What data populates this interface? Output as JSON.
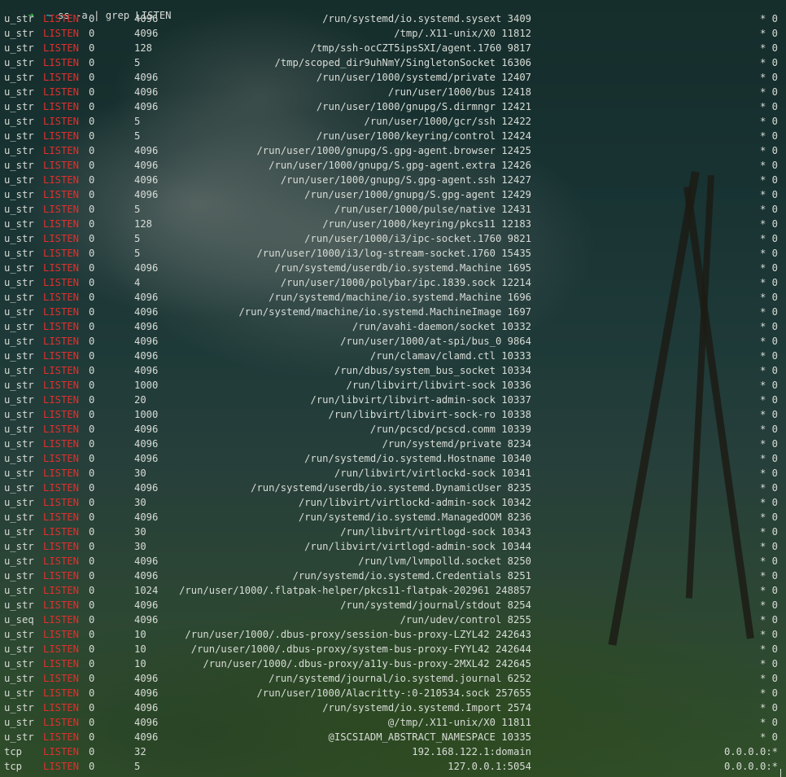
{
  "terminal": {
    "prompt": {
      "arrow": "➜",
      "cwd": "~",
      "command": "ss -a | grep LISTEN"
    },
    "colors": {
      "state": "#e0302c",
      "text": "#d8dcd6",
      "prompt_arrow": "#4ec45e",
      "prompt_cwd": "#3ec3d6"
    },
    "rows": [
      {
        "netid": "u_str",
        "state": "LISTEN",
        "recvq": "0",
        "sendq": "4096",
        "local": "/run/systemd/io.systemd.sysext 3409",
        "peer": "* 0"
      },
      {
        "netid": "u_str",
        "state": "LISTEN",
        "recvq": "0",
        "sendq": "4096",
        "local": "/tmp/.X11-unix/X0 11812",
        "peer": "* 0"
      },
      {
        "netid": "u_str",
        "state": "LISTEN",
        "recvq": "0",
        "sendq": "128",
        "local": "/tmp/ssh-ocCZT5ipsSXI/agent.1760 9817",
        "peer": "* 0"
      },
      {
        "netid": "u_str",
        "state": "LISTEN",
        "recvq": "0",
        "sendq": "5",
        "local": "/tmp/scoped_dir9uhNmY/SingletonSocket 16306",
        "peer": "* 0"
      },
      {
        "netid": "u_str",
        "state": "LISTEN",
        "recvq": "0",
        "sendq": "4096",
        "local": "/run/user/1000/systemd/private 12407",
        "peer": "* 0"
      },
      {
        "netid": "u_str",
        "state": "LISTEN",
        "recvq": "0",
        "sendq": "4096",
        "local": "/run/user/1000/bus 12418",
        "peer": "* 0"
      },
      {
        "netid": "u_str",
        "state": "LISTEN",
        "recvq": "0",
        "sendq": "4096",
        "local": "/run/user/1000/gnupg/S.dirmngr 12421",
        "peer": "* 0"
      },
      {
        "netid": "u_str",
        "state": "LISTEN",
        "recvq": "0",
        "sendq": "5",
        "local": "/run/user/1000/gcr/ssh 12422",
        "peer": "* 0"
      },
      {
        "netid": "u_str",
        "state": "LISTEN",
        "recvq": "0",
        "sendq": "5",
        "local": "/run/user/1000/keyring/control 12424",
        "peer": "* 0"
      },
      {
        "netid": "u_str",
        "state": "LISTEN",
        "recvq": "0",
        "sendq": "4096",
        "local": "/run/user/1000/gnupg/S.gpg-agent.browser 12425",
        "peer": "* 0"
      },
      {
        "netid": "u_str",
        "state": "LISTEN",
        "recvq": "0",
        "sendq": "4096",
        "local": "/run/user/1000/gnupg/S.gpg-agent.extra 12426",
        "peer": "* 0"
      },
      {
        "netid": "u_str",
        "state": "LISTEN",
        "recvq": "0",
        "sendq": "4096",
        "local": "/run/user/1000/gnupg/S.gpg-agent.ssh 12427",
        "peer": "* 0"
      },
      {
        "netid": "u_str",
        "state": "LISTEN",
        "recvq": "0",
        "sendq": "4096",
        "local": "/run/user/1000/gnupg/S.gpg-agent 12429",
        "peer": "* 0"
      },
      {
        "netid": "u_str",
        "state": "LISTEN",
        "recvq": "0",
        "sendq": "5",
        "local": "/run/user/1000/pulse/native 12431",
        "peer": "* 0"
      },
      {
        "netid": "u_str",
        "state": "LISTEN",
        "recvq": "0",
        "sendq": "128",
        "local": "/run/user/1000/keyring/pkcs11 12183",
        "peer": "* 0"
      },
      {
        "netid": "u_str",
        "state": "LISTEN",
        "recvq": "0",
        "sendq": "5",
        "local": "/run/user/1000/i3/ipc-socket.1760 9821",
        "peer": "* 0"
      },
      {
        "netid": "u_str",
        "state": "LISTEN",
        "recvq": "0",
        "sendq": "5",
        "local": "/run/user/1000/i3/log-stream-socket.1760 15435",
        "peer": "* 0"
      },
      {
        "netid": "u_str",
        "state": "LISTEN",
        "recvq": "0",
        "sendq": "4096",
        "local": "/run/systemd/userdb/io.systemd.Machine 1695",
        "peer": "* 0"
      },
      {
        "netid": "u_str",
        "state": "LISTEN",
        "recvq": "0",
        "sendq": "4",
        "local": "/run/user/1000/polybar/ipc.1839.sock 12214",
        "peer": "* 0"
      },
      {
        "netid": "u_str",
        "state": "LISTEN",
        "recvq": "0",
        "sendq": "4096",
        "local": "/run/systemd/machine/io.systemd.Machine 1696",
        "peer": "* 0"
      },
      {
        "netid": "u_str",
        "state": "LISTEN",
        "recvq": "0",
        "sendq": "4096",
        "local": "/run/systemd/machine/io.systemd.MachineImage 1697",
        "peer": "* 0"
      },
      {
        "netid": "u_str",
        "state": "LISTEN",
        "recvq": "0",
        "sendq": "4096",
        "local": "/run/avahi-daemon/socket 10332",
        "peer": "* 0"
      },
      {
        "netid": "u_str",
        "state": "LISTEN",
        "recvq": "0",
        "sendq": "4096",
        "local": "/run/user/1000/at-spi/bus_0 9864",
        "peer": "* 0"
      },
      {
        "netid": "u_str",
        "state": "LISTEN",
        "recvq": "0",
        "sendq": "4096",
        "local": "/run/clamav/clamd.ctl 10333",
        "peer": "* 0"
      },
      {
        "netid": "u_str",
        "state": "LISTEN",
        "recvq": "0",
        "sendq": "4096",
        "local": "/run/dbus/system_bus_socket 10334",
        "peer": "* 0"
      },
      {
        "netid": "u_str",
        "state": "LISTEN",
        "recvq": "0",
        "sendq": "1000",
        "local": "/run/libvirt/libvirt-sock 10336",
        "peer": "* 0"
      },
      {
        "netid": "u_str",
        "state": "LISTEN",
        "recvq": "0",
        "sendq": "20",
        "local": "/run/libvirt/libvirt-admin-sock 10337",
        "peer": "* 0"
      },
      {
        "netid": "u_str",
        "state": "LISTEN",
        "recvq": "0",
        "sendq": "1000",
        "local": "/run/libvirt/libvirt-sock-ro 10338",
        "peer": "* 0"
      },
      {
        "netid": "u_str",
        "state": "LISTEN",
        "recvq": "0",
        "sendq": "4096",
        "local": "/run/pcscd/pcscd.comm 10339",
        "peer": "* 0"
      },
      {
        "netid": "u_str",
        "state": "LISTEN",
        "recvq": "0",
        "sendq": "4096",
        "local": "/run/systemd/private 8234",
        "peer": "* 0"
      },
      {
        "netid": "u_str",
        "state": "LISTEN",
        "recvq": "0",
        "sendq": "4096",
        "local": "/run/systemd/io.systemd.Hostname 10340",
        "peer": "* 0"
      },
      {
        "netid": "u_str",
        "state": "LISTEN",
        "recvq": "0",
        "sendq": "30",
        "local": "/run/libvirt/virtlockd-sock 10341",
        "peer": "* 0"
      },
      {
        "netid": "u_str",
        "state": "LISTEN",
        "recvq": "0",
        "sendq": "4096",
        "local": "/run/systemd/userdb/io.systemd.DynamicUser 8235",
        "peer": "* 0"
      },
      {
        "netid": "u_str",
        "state": "LISTEN",
        "recvq": "0",
        "sendq": "30",
        "local": "/run/libvirt/virtlockd-admin-sock 10342",
        "peer": "* 0"
      },
      {
        "netid": "u_str",
        "state": "LISTEN",
        "recvq": "0",
        "sendq": "4096",
        "local": "/run/systemd/io.systemd.ManagedOOM 8236",
        "peer": "* 0"
      },
      {
        "netid": "u_str",
        "state": "LISTEN",
        "recvq": "0",
        "sendq": "30",
        "local": "/run/libvirt/virtlogd-sock 10343",
        "peer": "* 0"
      },
      {
        "netid": "u_str",
        "state": "LISTEN",
        "recvq": "0",
        "sendq": "30",
        "local": "/run/libvirt/virtlogd-admin-sock 10344",
        "peer": "* 0"
      },
      {
        "netid": "u_str",
        "state": "LISTEN",
        "recvq": "0",
        "sendq": "4096",
        "local": "/run/lvm/lvmpolld.socket 8250",
        "peer": "* 0"
      },
      {
        "netid": "u_str",
        "state": "LISTEN",
        "recvq": "0",
        "sendq": "4096",
        "local": "/run/systemd/io.systemd.Credentials 8251",
        "peer": "* 0"
      },
      {
        "netid": "u_str",
        "state": "LISTEN",
        "recvq": "0",
        "sendq": "1024",
        "local": "/run/user/1000/.flatpak-helper/pkcs11-flatpak-202961 248857",
        "peer": "* 0"
      },
      {
        "netid": "u_str",
        "state": "LISTEN",
        "recvq": "0",
        "sendq": "4096",
        "local": "/run/systemd/journal/stdout 8254",
        "peer": "* 0"
      },
      {
        "netid": "u_seq",
        "state": "LISTEN",
        "recvq": "0",
        "sendq": "4096",
        "local": "/run/udev/control 8255",
        "peer": "* 0"
      },
      {
        "netid": "u_str",
        "state": "LISTEN",
        "recvq": "0",
        "sendq": "10",
        "local": "/run/user/1000/.dbus-proxy/session-bus-proxy-LZYL42 242643",
        "peer": "* 0"
      },
      {
        "netid": "u_str",
        "state": "LISTEN",
        "recvq": "0",
        "sendq": "10",
        "local": "/run/user/1000/.dbus-proxy/system-bus-proxy-FYYL42 242644",
        "peer": "* 0"
      },
      {
        "netid": "u_str",
        "state": "LISTEN",
        "recvq": "0",
        "sendq": "10",
        "local": "/run/user/1000/.dbus-proxy/a11y-bus-proxy-2MXL42 242645",
        "peer": "* 0"
      },
      {
        "netid": "u_str",
        "state": "LISTEN",
        "recvq": "0",
        "sendq": "4096",
        "local": "/run/systemd/journal/io.systemd.journal 6252",
        "peer": "* 0"
      },
      {
        "netid": "u_str",
        "state": "LISTEN",
        "recvq": "0",
        "sendq": "4096",
        "local": "/run/user/1000/Alacritty-:0-210534.sock 257655",
        "peer": "* 0"
      },
      {
        "netid": "u_str",
        "state": "LISTEN",
        "recvq": "0",
        "sendq": "4096",
        "local": "/run/systemd/io.systemd.Import 2574",
        "peer": "* 0"
      },
      {
        "netid": "u_str",
        "state": "LISTEN",
        "recvq": "0",
        "sendq": "4096",
        "local": "@/tmp/.X11-unix/X0 11811",
        "peer": "* 0"
      },
      {
        "netid": "u_str",
        "state": "LISTEN",
        "recvq": "0",
        "sendq": "4096",
        "local": "@ISCSIADM_ABSTRACT_NAMESPACE 10335",
        "peer": "* 0"
      },
      {
        "netid": "tcp",
        "state": "LISTEN",
        "recvq": "0",
        "sendq": "32",
        "local": "192.168.122.1:domain",
        "peer": "0.0.0.0:*"
      },
      {
        "netid": "tcp",
        "state": "LISTEN",
        "recvq": "0",
        "sendq": "5",
        "local": "127.0.0.1:5054",
        "peer": "0.0.0.0:*"
      }
    ]
  }
}
